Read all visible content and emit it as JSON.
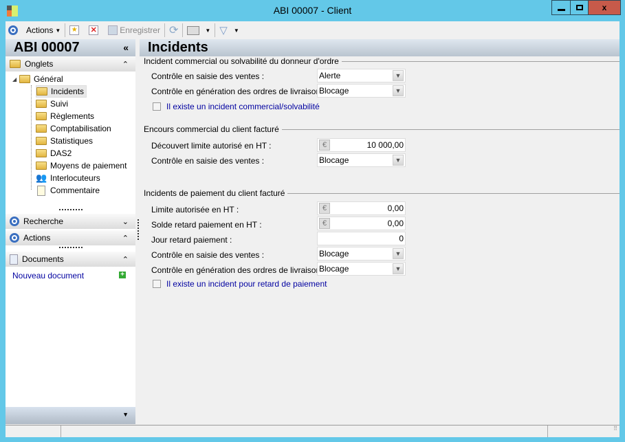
{
  "window": {
    "title": "ABI 00007 -  Client"
  },
  "toolbar": {
    "actions": "Actions",
    "save": "Enregistrer"
  },
  "left": {
    "record_id": "ABI 00007",
    "tabs_header": "Onglets",
    "tree": {
      "root": "Général",
      "items": [
        "Incidents",
        "Suivi",
        "Règlements",
        "Comptabilisation",
        "Statistiques",
        "DAS2",
        "Moyens de paiement",
        "Interlocuteurs",
        "Commentaire"
      ],
      "selected": "Incidents"
    },
    "panes": {
      "search": "Recherche",
      "actions": "Actions",
      "documents": "Documents"
    },
    "new_document": "Nouveau document"
  },
  "main": {
    "title": "Incidents",
    "s1": {
      "title": "Incident commercial ou solvabilité du donneur d'ordre",
      "l1": "Contrôle en saisie des ventes :",
      "v1": "Alerte",
      "l2": "Contrôle en génération des ordres de livraison :",
      "v2": "Blocage",
      "check": "Il existe un incident commercial/solvabilité"
    },
    "s2": {
      "title": "Encours commercial du client facturé",
      "l1": "Découvert limite autorisé en HT :",
      "v1": "10 000,00",
      "l2": "Contrôle en saisie des ventes :",
      "v2": "Blocage"
    },
    "s3": {
      "title": "Incidents de paiement du client facturé",
      "l1": "Limite autorisée en HT :",
      "v1": "0,00",
      "l2": "Solde retard paiement en HT :",
      "v2": "0,00",
      "l3": "Jour retard paiement  :",
      "v3": "0",
      "l4": "Contrôle en saisie des ventes :",
      "v4": "Blocage",
      "l5": "Contrôle en génération des ordres de livraison :",
      "v5": "Blocage",
      "check": "Il existe un incident pour retard de paiement"
    }
  }
}
